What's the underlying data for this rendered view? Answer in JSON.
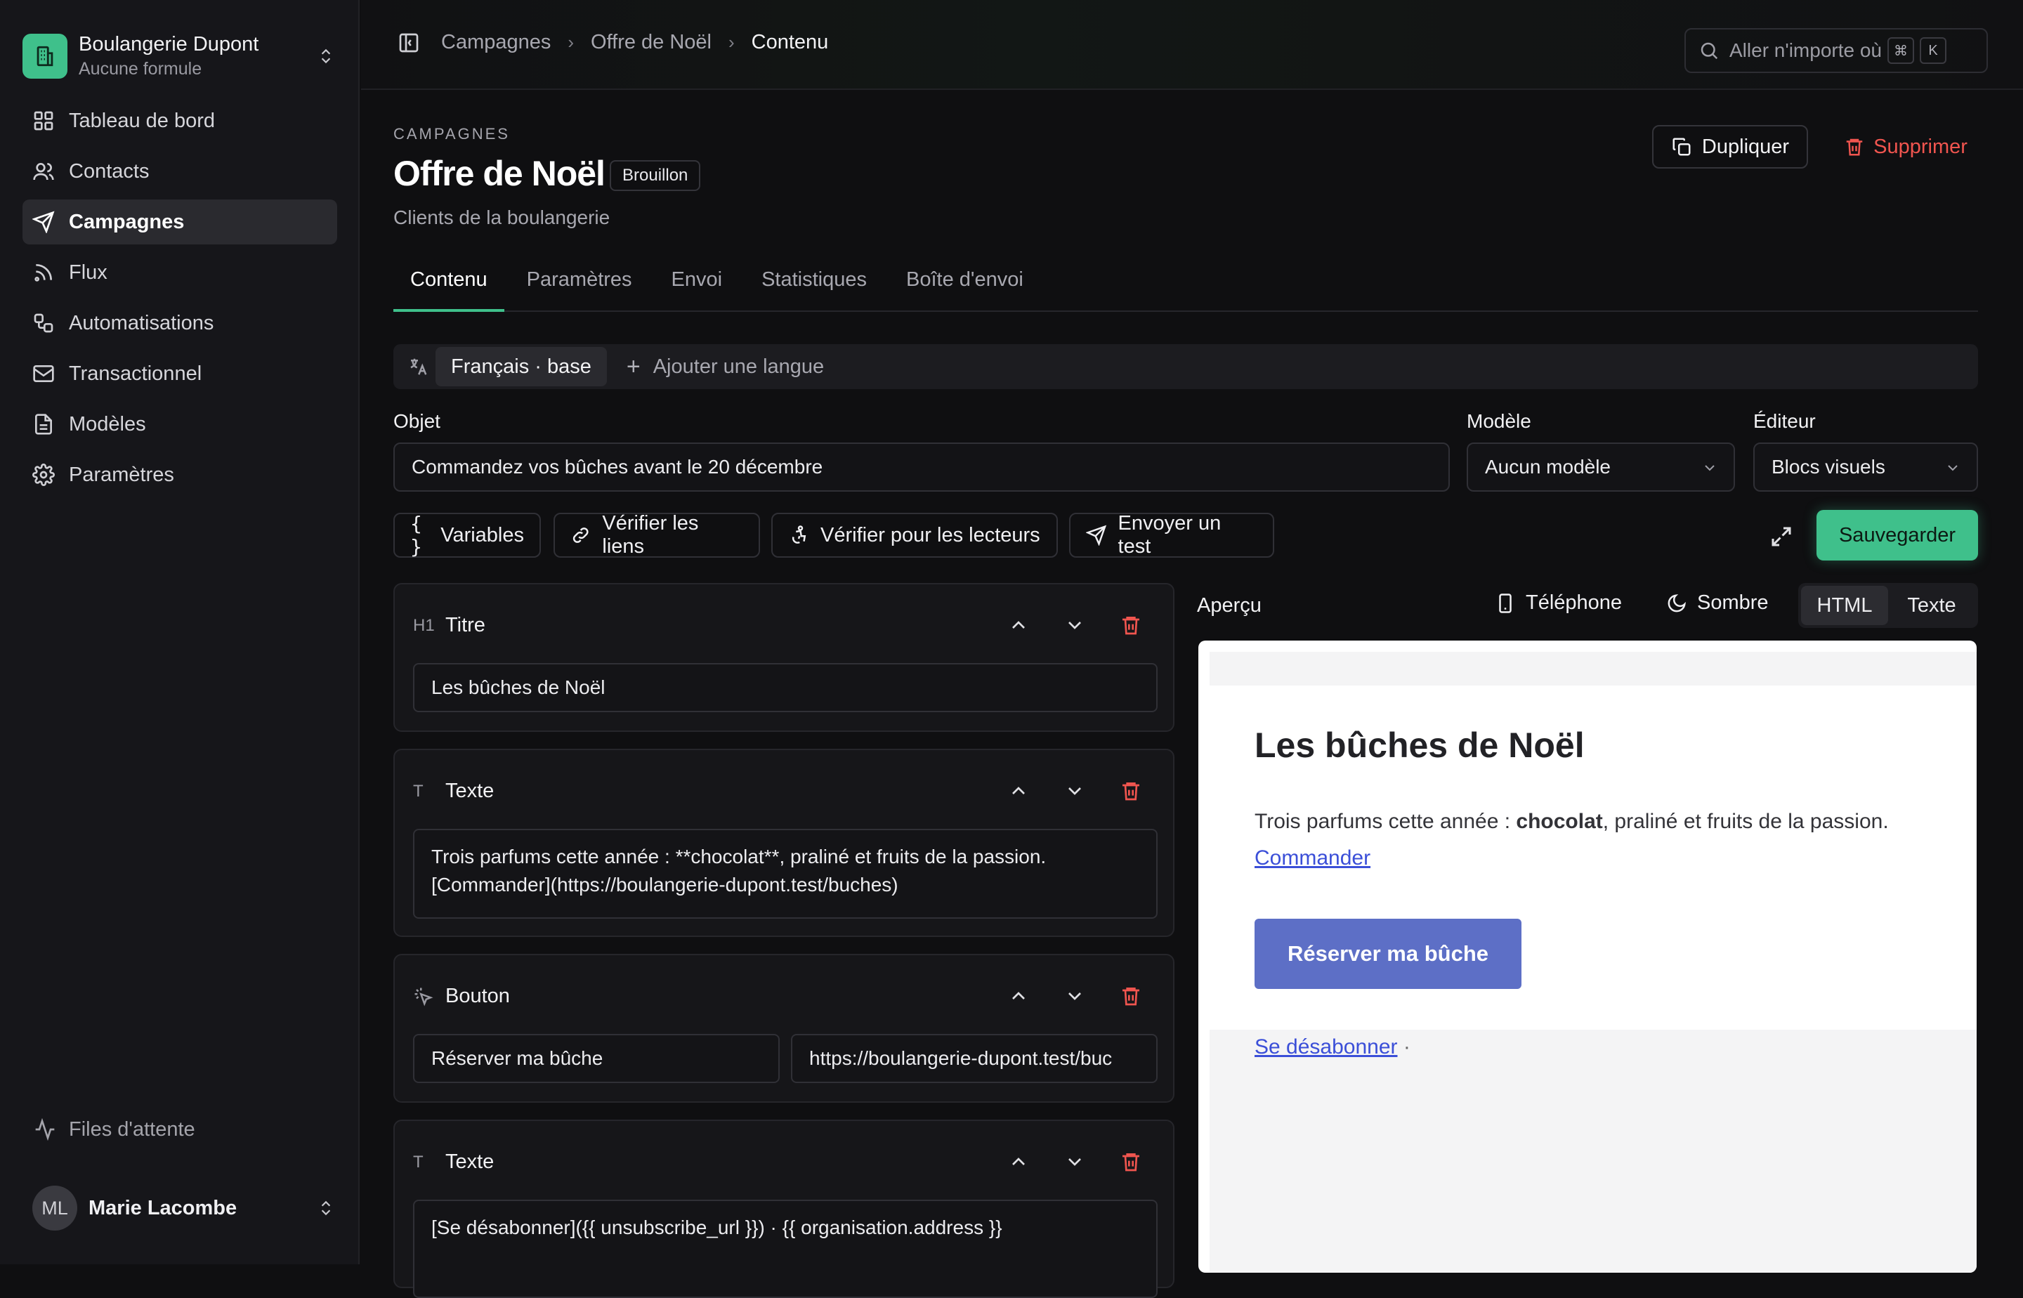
{
  "org": {
    "name": "Boulangerie Dupont",
    "plan": "Aucune formule"
  },
  "nav": [
    {
      "label": "Tableau de bord",
      "icon": "dashboard-icon"
    },
    {
      "label": "Contacts",
      "icon": "users-icon"
    },
    {
      "label": "Campagnes",
      "icon": "send-icon",
      "active": true
    },
    {
      "label": "Flux",
      "icon": "rss-icon"
    },
    {
      "label": "Automatisations",
      "icon": "workflow-icon"
    },
    {
      "label": "Transactionnel",
      "icon": "mail-icon"
    },
    {
      "label": "Modèles",
      "icon": "file-icon"
    },
    {
      "label": "Paramètres",
      "icon": "gear-icon"
    }
  ],
  "queue_label": "Files d'attente",
  "user": {
    "initials": "ML",
    "name": "Marie Lacombe"
  },
  "breadcrumb": [
    "Campagnes",
    "Offre de Noël",
    "Contenu"
  ],
  "search": {
    "placeholder": "Aller n'importe où",
    "kbd1": "⌘",
    "kbd2": "K"
  },
  "header": {
    "section": "CAMPAGNES",
    "title": "Offre de Noël",
    "status": "Brouillon",
    "subtitle": "Clients de la boulangerie",
    "duplicate": "Dupliquer",
    "delete": "Supprimer"
  },
  "tabs": [
    "Contenu",
    "Paramètres",
    "Envoi",
    "Statistiques",
    "Boîte d'envoi"
  ],
  "language": {
    "current": "Français · base",
    "add": "Ajouter une langue"
  },
  "fields": {
    "subject_label": "Objet",
    "subject_value": "Commandez vos bûches avant le 20 décembre",
    "template_label": "Modèle",
    "template_value": "Aucun modèle",
    "editor_label": "Éditeur",
    "editor_value": "Blocs visuels"
  },
  "toolbar": {
    "variables": "Variables",
    "check_links": "Vérifier les liens",
    "accessibility": "Vérifier pour les lecteurs",
    "send_test": "Envoyer un test",
    "save": "Sauvegarder"
  },
  "blocks": {
    "title": {
      "label": "Titre",
      "icon": "H1",
      "value": "Les bûches de Noël"
    },
    "text1": {
      "label": "Texte",
      "icon": "T",
      "value": "Trois parfums cette année : **chocolat**, praliné et fruits de la passion. [Commander](https://boulangerie-dupont.test/buches)"
    },
    "button": {
      "label": "Bouton",
      "label_value": "Réserver ma bûche",
      "url_value": "https://boulangerie-dupont.test/buc"
    },
    "text2": {
      "label": "Texte",
      "icon": "T",
      "value": "[Se désabonner]({{ unsubscribe_url }}) · {{ organisation.address }}"
    }
  },
  "preview": {
    "label": "Aperçu",
    "phone": "Téléphone",
    "dark": "Sombre",
    "html": "HTML",
    "text": "Texte",
    "title": "Les bûches de Noël",
    "para_before": "Trois parfums cette année : ",
    "para_bold": "chocolat",
    "para_after": ", praliné et fruits de la passion.",
    "link": "Commander",
    "button": "Réserver ma bûche",
    "unsubscribe": "Se désabonner",
    "after_unsub": " ·"
  },
  "colors": {
    "accent": "#3fc08b",
    "danger": "#f0554f",
    "preview_button": "#5d6fc6"
  }
}
